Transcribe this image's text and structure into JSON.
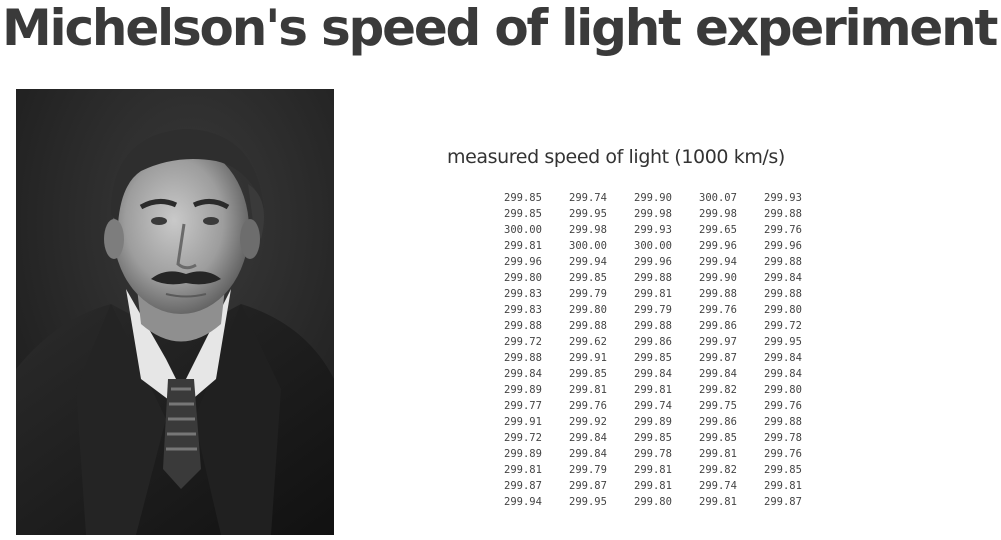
{
  "page": {
    "title": "Michelson's speed of light experiment"
  },
  "portrait": {
    "alt": "Albert A. Michelson portrait"
  },
  "measurements": {
    "heading": "measured speed of light (1000 km/s)",
    "rows": [
      [
        "299.85",
        "299.74",
        "299.90",
        "300.07",
        "299.93"
      ],
      [
        "299.85",
        "299.95",
        "299.98",
        "299.98",
        "299.88"
      ],
      [
        "300.00",
        "299.98",
        "299.93",
        "299.65",
        "299.76"
      ],
      [
        "299.81",
        "300.00",
        "300.00",
        "299.96",
        "299.96"
      ],
      [
        "299.96",
        "299.94",
        "299.96",
        "299.94",
        "299.88"
      ],
      [
        "299.80",
        "299.85",
        "299.88",
        "299.90",
        "299.84"
      ],
      [
        "299.83",
        "299.79",
        "299.81",
        "299.88",
        "299.88"
      ],
      [
        "299.83",
        "299.80",
        "299.79",
        "299.76",
        "299.80"
      ],
      [
        "299.88",
        "299.88",
        "299.88",
        "299.86",
        "299.72"
      ],
      [
        "299.72",
        "299.62",
        "299.86",
        "299.97",
        "299.95"
      ],
      [
        "299.88",
        "299.91",
        "299.85",
        "299.87",
        "299.84"
      ],
      [
        "299.84",
        "299.85",
        "299.84",
        "299.84",
        "299.84"
      ],
      [
        "299.89",
        "299.81",
        "299.81",
        "299.82",
        "299.80"
      ],
      [
        "299.77",
        "299.76",
        "299.74",
        "299.75",
        "299.76"
      ],
      [
        "299.91",
        "299.92",
        "299.89",
        "299.86",
        "299.88"
      ],
      [
        "299.72",
        "299.84",
        "299.85",
        "299.85",
        "299.78"
      ],
      [
        "299.89",
        "299.84",
        "299.78",
        "299.81",
        "299.76"
      ],
      [
        "299.81",
        "299.79",
        "299.81",
        "299.82",
        "299.85"
      ],
      [
        "299.87",
        "299.87",
        "299.81",
        "299.74",
        "299.81"
      ],
      [
        "299.94",
        "299.95",
        "299.80",
        "299.81",
        "299.87"
      ]
    ]
  }
}
